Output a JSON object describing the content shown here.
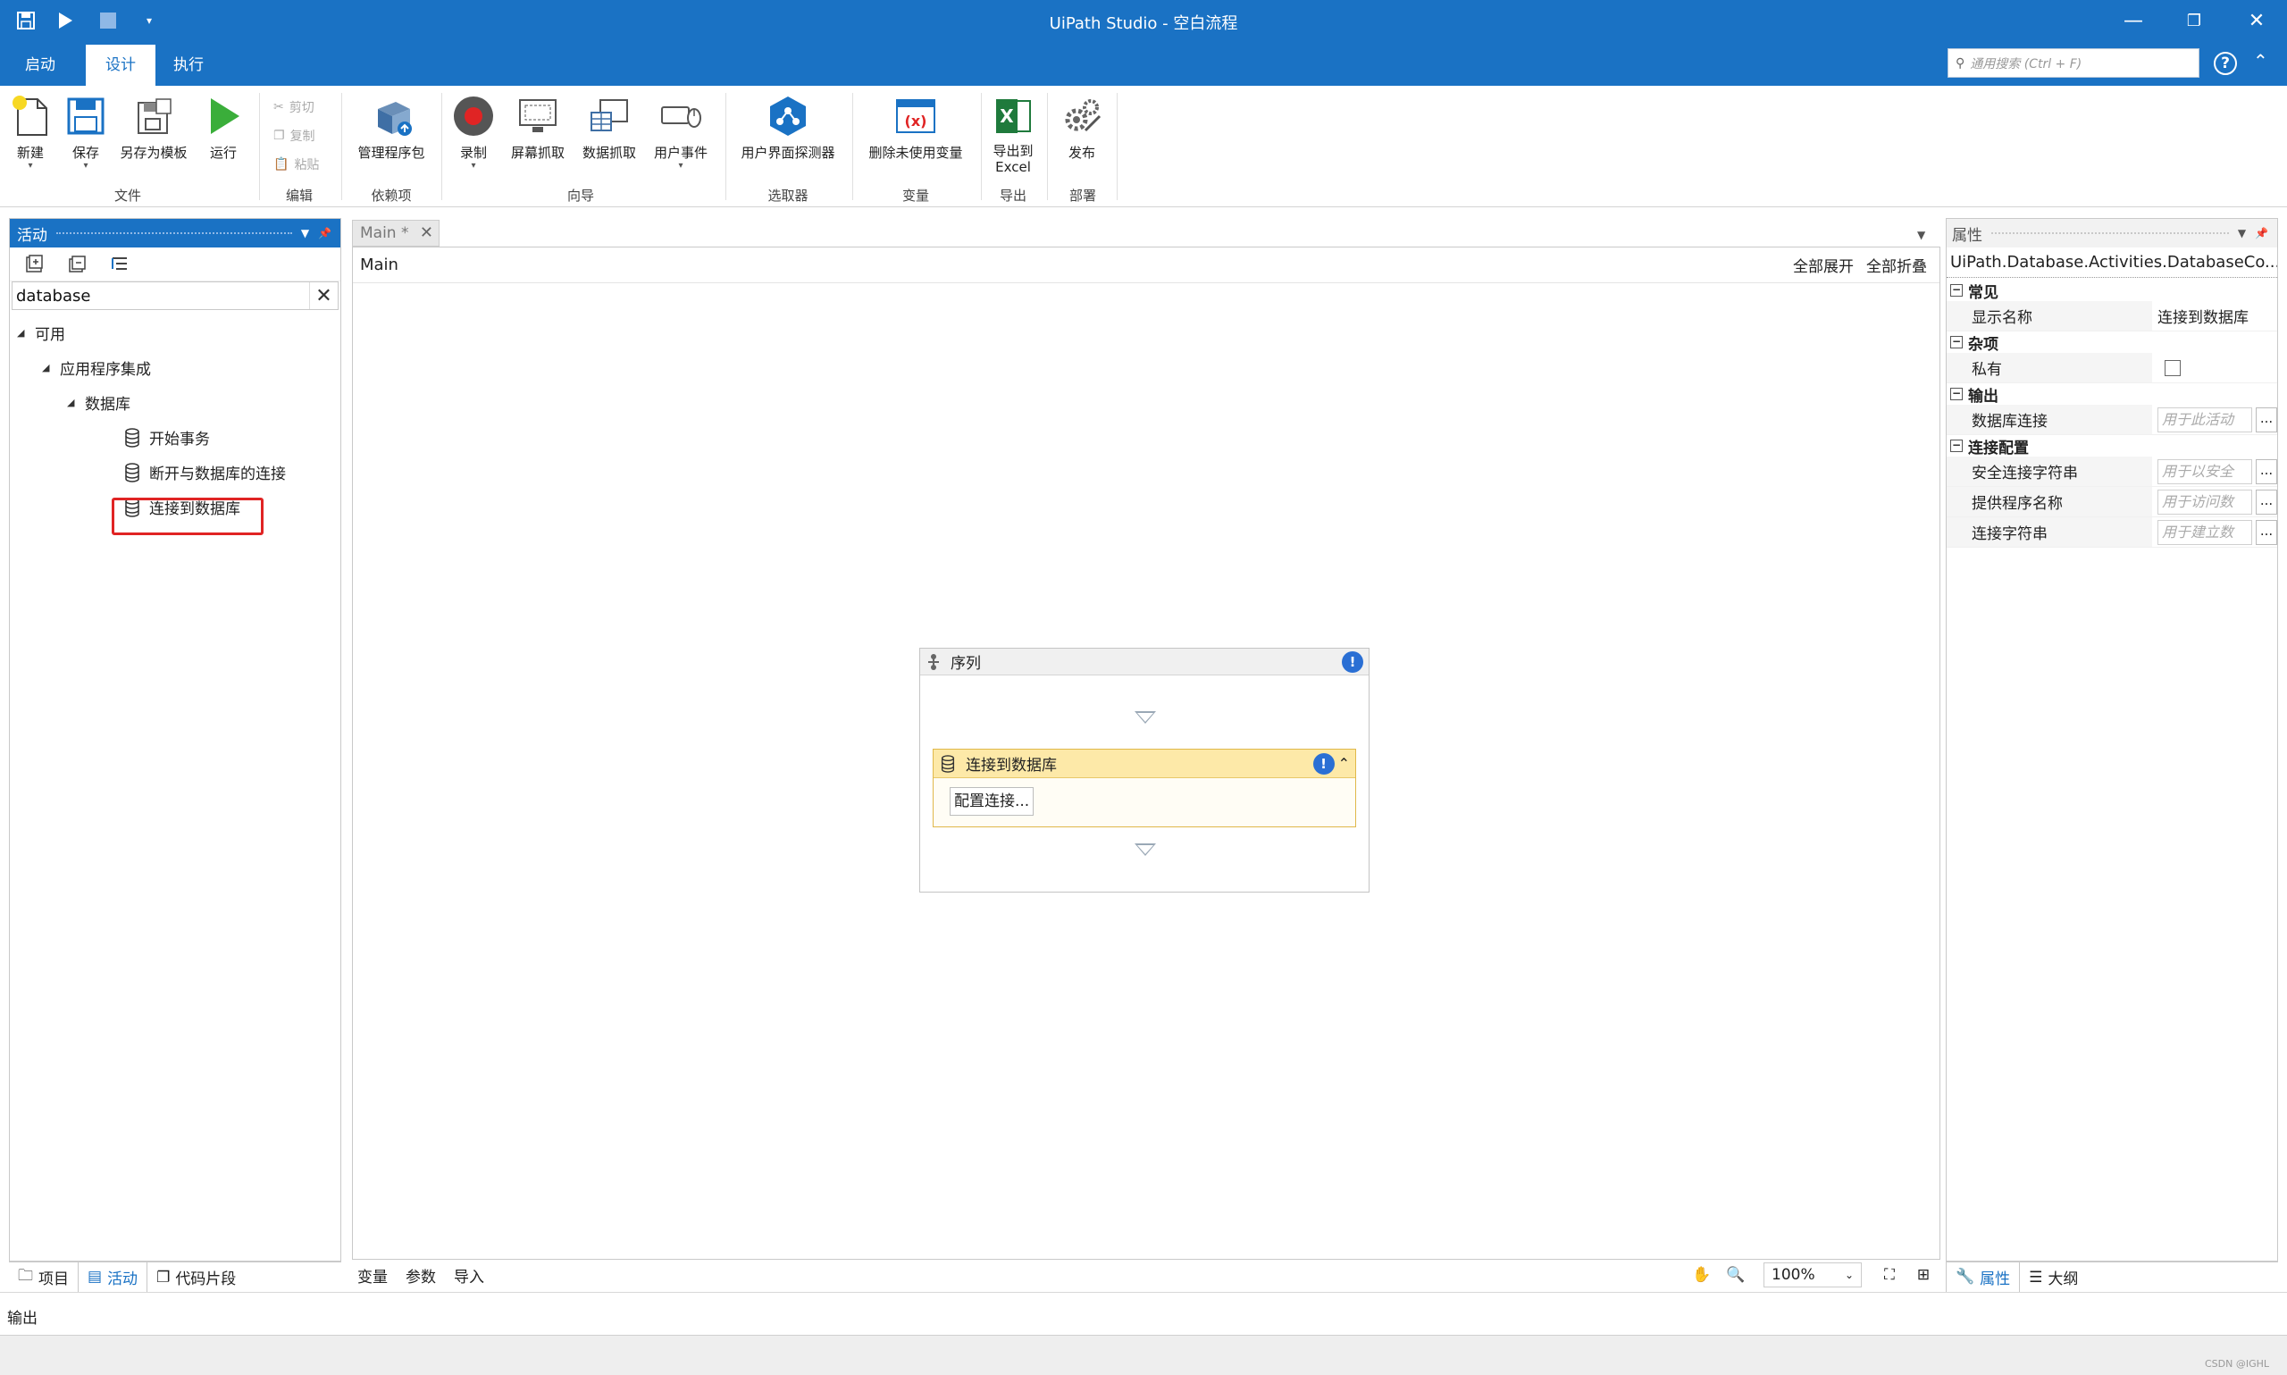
{
  "window": {
    "title": "UiPath Studio - 空白流程",
    "minimize": "—",
    "restore": "❐",
    "close": "✕"
  },
  "menu_tabs": [
    "启动",
    "设计",
    "执行"
  ],
  "active_tab": "设计",
  "search": {
    "placeholder": "通用搜索 (Ctrl + F)"
  },
  "ribbon": {
    "file": {
      "new": "新建",
      "save": "保存",
      "save_as_template": "另存为模板",
      "run": "运行",
      "group": "文件"
    },
    "edit": {
      "cut": "剪切",
      "copy": "复制",
      "paste": "粘贴",
      "group": "编辑"
    },
    "deps": {
      "manage_packages": "管理程序包",
      "group": "依赖项"
    },
    "wizards": {
      "record": "录制",
      "screen_scraping": "屏幕抓取",
      "data_scraping": "数据抓取",
      "user_events": "用户事件",
      "group": "向导"
    },
    "selectors": {
      "ui_explorer": "用户界面探测器",
      "group": "选取器"
    },
    "variables": {
      "remove_unused": "删除未使用变量",
      "group": "变量"
    },
    "export": {
      "export_excel_1": "导出到",
      "export_excel_2": "Excel",
      "group": "导出"
    },
    "deploy": {
      "publish": "发布",
      "group": "部署"
    }
  },
  "activities_panel": {
    "title": "活动",
    "filter_value": "database",
    "tree": [
      {
        "label": "可用",
        "level": 0,
        "expanded": true
      },
      {
        "label": "应用程序集成",
        "level": 1,
        "expanded": true
      },
      {
        "label": "数据库",
        "level": 2,
        "expanded": true
      },
      {
        "label": "开始事务",
        "level": 3,
        "icon": "database-icon"
      },
      {
        "label": "断开与数据库的连接",
        "level": 3,
        "icon": "database-icon"
      },
      {
        "label": "连接到数据库",
        "level": 3,
        "icon": "database-icon",
        "highlighted": true
      }
    ],
    "bottom_tabs": [
      "项目",
      "活动",
      "代码片段"
    ],
    "active_bottom_tab": "活动"
  },
  "designer": {
    "doc_tab": "Main *",
    "breadcrumb": "Main",
    "expand_all": "全部展开",
    "collapse_all": "全部折叠",
    "sequence": {
      "title": "序列",
      "activity": {
        "title": "连接到数据库",
        "button": "配置连接..."
      }
    },
    "bottom_tabs": [
      "变量",
      "参数",
      "导入"
    ],
    "zoom": "100%"
  },
  "properties_panel": {
    "title": "属性",
    "type_name": "UiPath.Database.Activities.DatabaseCo...",
    "categories": [
      {
        "name": "常见",
        "rows": [
          {
            "name": "显示名称",
            "value": "连接到数据库",
            "kind": "text"
          }
        ]
      },
      {
        "name": "杂项",
        "rows": [
          {
            "name": "私有",
            "kind": "checkbox"
          }
        ]
      },
      {
        "name": "输出",
        "rows": [
          {
            "name": "数据库连接",
            "placeholder": "用于此活动",
            "kind": "input"
          }
        ]
      },
      {
        "name": "连接配置",
        "rows": [
          {
            "name": "安全连接字符串",
            "placeholder": "用于以安全",
            "kind": "input"
          },
          {
            "name": "提供程序名称",
            "placeholder": "用于访问数",
            "kind": "input"
          },
          {
            "name": "连接字符串",
            "placeholder": "用于建立数",
            "kind": "input"
          }
        ]
      }
    ],
    "ellipsis": "...",
    "bottom_tabs": [
      "属性",
      "大纲"
    ],
    "active_bottom_tab": "属性"
  },
  "output_bar": {
    "label": "输出"
  },
  "watermark": "CSDN @IGHL",
  "colors": {
    "accent": "#1a72c4",
    "highlight": "#e02424",
    "activity_header": "#fde9a8"
  }
}
